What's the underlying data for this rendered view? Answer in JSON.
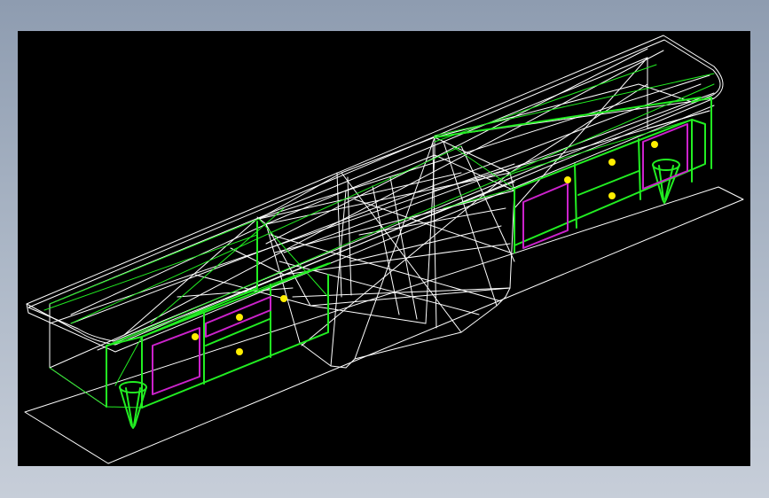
{
  "viewport": {
    "background": "#000000",
    "colors": {
      "edges": "#ffffff",
      "frame": "#22ee22",
      "panels": "#cc22cc",
      "knobs": "#ffee00"
    }
  }
}
